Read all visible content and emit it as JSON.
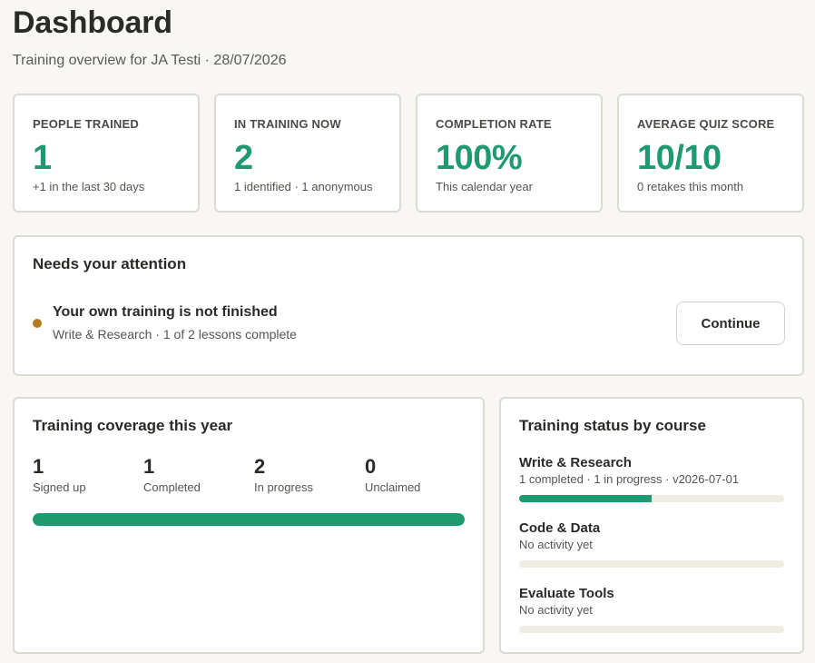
{
  "header": {
    "title": "Dashboard",
    "subtitle": "Training overview for JA Testi · 28/07/2026"
  },
  "stats": [
    {
      "label": "PEOPLE TRAINED",
      "value": "1",
      "sub": "+1 in the last 30 days"
    },
    {
      "label": "IN TRAINING NOW",
      "value": "2",
      "sub": "1 identified · 1 anonymous"
    },
    {
      "label": "COMPLETION RATE",
      "value": "100%",
      "sub": "This calendar year"
    },
    {
      "label": "AVERAGE QUIZ SCORE",
      "value": "10/10",
      "sub": "0 retakes this month"
    }
  ],
  "attention": {
    "heading": "Needs your attention",
    "item_title": "Your own training is not finished",
    "item_sub": "Write & Research · 1 of 2 lessons complete",
    "button_label": "Continue",
    "dot_color": "#b7791f"
  },
  "coverage": {
    "heading": "Training coverage this year",
    "stats": [
      {
        "value": "1",
        "label": "Signed up"
      },
      {
        "value": "1",
        "label": "Completed"
      },
      {
        "value": "2",
        "label": "In progress"
      },
      {
        "value": "0",
        "label": "Unclaimed"
      }
    ],
    "progress_fraction": 1.0
  },
  "status": {
    "heading": "Training status by course",
    "courses": [
      {
        "name": "Write & Research",
        "sub": "1 completed · 1 in progress · v2026-07-01",
        "progress_fraction": 0.5
      },
      {
        "name": "Code & Data",
        "sub": "No activity yet",
        "progress_fraction": 0
      },
      {
        "name": "Evaluate Tools",
        "sub": "No activity yet",
        "progress_fraction": 0
      }
    ]
  },
  "colors": {
    "accent": "#1f9a6f",
    "background": "#f8f7f3",
    "warning": "#b7791f"
  }
}
